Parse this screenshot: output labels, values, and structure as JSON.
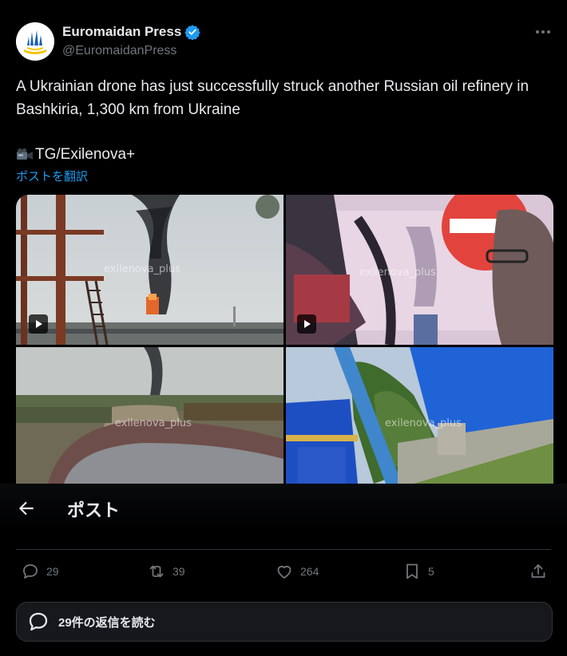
{
  "author": {
    "name": "Euromaidan Press",
    "handle": "@EuromaidanPress",
    "verified": true
  },
  "tweet": {
    "text": "A Ukrainian drone has just successfully struck another Russian oil refinery in Bashkiria, 1,300 km from Ukraine",
    "source_line": "TG/Exilenova+",
    "source_icon": "video-camera-icon",
    "translate_label": "ポストを翻訳"
  },
  "media": {
    "watermarks": [
      "exilenova_plus",
      "exilenova_plus",
      "exilenova_plus",
      "exilenova_plus"
    ]
  },
  "header_overlay": {
    "title": "ポスト"
  },
  "actions": {
    "replies": "29",
    "reposts": "39",
    "likes": "264",
    "bookmarks": "5"
  },
  "read_replies_label": "29件の返信を読む",
  "colors": {
    "background": "#000000",
    "text": "#e7e9ea",
    "muted": "#71767b",
    "link": "#1d9bf0",
    "verified": "#1d9bf0"
  }
}
